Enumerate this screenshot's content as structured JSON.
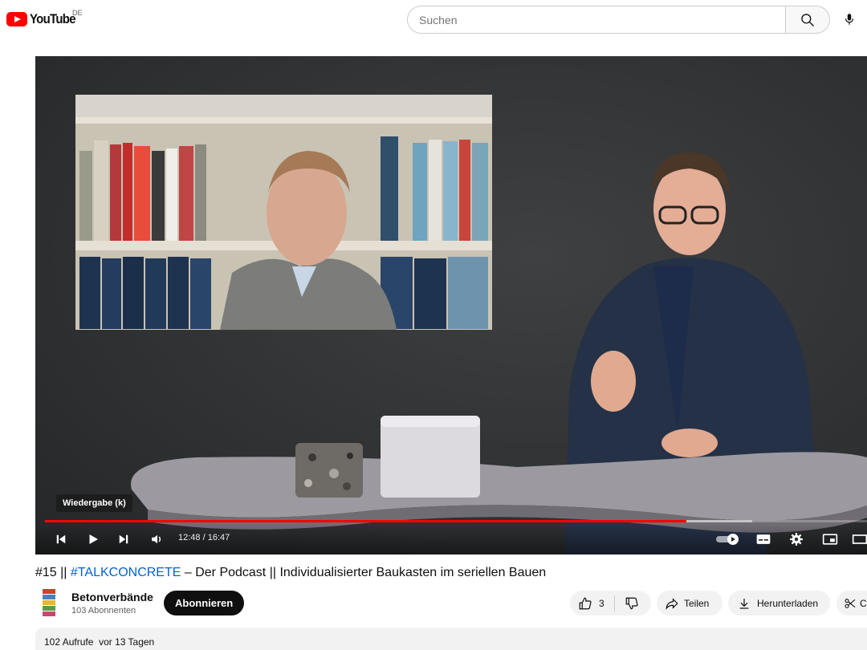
{
  "masthead": {
    "logo_text": "YouTube",
    "country_code": "DE",
    "search_placeholder": "Suchen"
  },
  "player": {
    "tooltip": "Wiedergabe (k)",
    "time_current": "12:48",
    "time_total": "16:47",
    "progress_fraction": 0.78,
    "buffer_fraction": 0.86
  },
  "video": {
    "title_prefix": "#15 || ",
    "title_hashtag": "#TALKCONCRETE",
    "title_rest": " – Der Podcast || Individualisierter Baukasten im seriellen Bauen"
  },
  "channel": {
    "name": "Betonverbände",
    "subscribers": "103 Abonnenten",
    "subscribe_label": "Abonnieren"
  },
  "actions": {
    "like_count": "3",
    "share_label": "Teilen",
    "download_label": "Herunterladen",
    "clip_label": "C"
  },
  "description": {
    "views": "102 Aufrufe",
    "date": "vor 13 Tagen"
  },
  "colors": {
    "brand_red": "#ff0000",
    "link_blue": "#065fd4"
  }
}
